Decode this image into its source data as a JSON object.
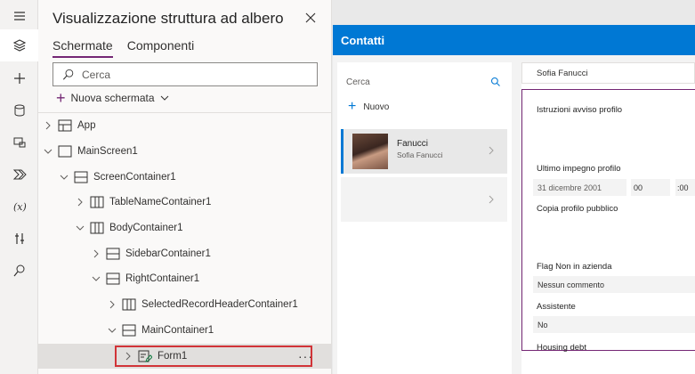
{
  "tree_view": {
    "title": "Visualizzazione struttura ad albero",
    "tabs": [
      "Schermate",
      "Componenti"
    ],
    "search_placeholder": "Cerca",
    "new_screen_label": "Nuova schermata",
    "nodes": {
      "app": "App",
      "main_screen": "MainScreen1",
      "screen_container": "ScreenContainer1",
      "table_name_container": "TableNameContainer1",
      "body_container": "BodyContainer1",
      "sidebar_container": "SidebarContainer1",
      "right_container": "RightContainer1",
      "selected_record_header": "SelectedRecordHeaderContainer1",
      "main_container": "MainContainer1",
      "form": "Form1"
    },
    "more_label": "···"
  },
  "app_preview": {
    "header_title": "Contatti",
    "sidebar": {
      "search_placeholder": "Cerca",
      "new_label": "Nuovo",
      "contact_last_name": "Fanucci",
      "contact_full_name": "Sofia Fanucci"
    },
    "record_header": "Sofia Fanucci",
    "form": {
      "label_1": "Istruzioni avviso profilo",
      "label_2": "Ultimo impegno profilo",
      "date_value": "31 dicembre 2001",
      "hour_value": "00",
      "minute_value": ":00",
      "label_3": "Copia profilo pubblico",
      "label_4": "Flag Non in azienda",
      "value_4": "Nessun commento",
      "label_5": "Assistente",
      "value_5": "No",
      "label_6": "Housing debt"
    }
  },
  "colors": {
    "accent_purple": "#742774",
    "header_blue": "#0078d4",
    "selection_red": "#d13438"
  }
}
